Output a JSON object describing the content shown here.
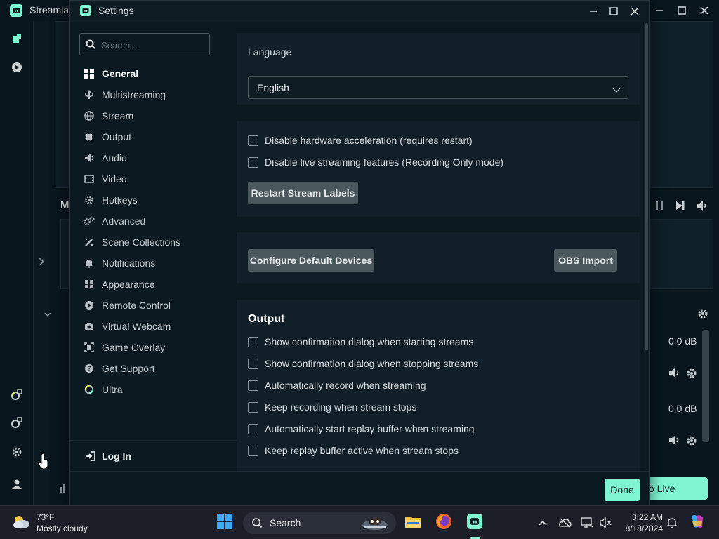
{
  "background_app": {
    "name": "Streamlabs",
    "mixer_label": "M",
    "db_values": [
      "0.0 dB",
      "0.0 dB"
    ],
    "go_live_label": "o Live"
  },
  "dialog": {
    "title": "Settings",
    "search": {
      "placeholder": "Search..."
    },
    "nav_items": [
      {
        "label": "General",
        "icon": "grid-icon"
      },
      {
        "label": "Multistreaming",
        "icon": "usb-fork-icon"
      },
      {
        "label": "Stream",
        "icon": "globe-icon"
      },
      {
        "label": "Output",
        "icon": "chip-icon"
      },
      {
        "label": "Audio",
        "icon": "speaker-icon"
      },
      {
        "label": "Video",
        "icon": "film-icon"
      },
      {
        "label": "Hotkeys",
        "icon": "gear-icon"
      },
      {
        "label": "Advanced",
        "icon": "gears-icon"
      },
      {
        "label": "Scene Collections",
        "icon": "wand-icon"
      },
      {
        "label": "Notifications",
        "icon": "bell-icon"
      },
      {
        "label": "Appearance",
        "icon": "palette-icon"
      },
      {
        "label": "Remote Control",
        "icon": "play-circle-icon"
      },
      {
        "label": "Virtual Webcam",
        "icon": "camera-icon"
      },
      {
        "label": "Game Overlay",
        "icon": "overlay-icon"
      },
      {
        "label": "Get Support",
        "icon": "question-icon"
      },
      {
        "label": "Ultra",
        "icon": "ultra-ring-icon"
      }
    ],
    "active_nav": "General",
    "login_label": "Log In",
    "language": {
      "label": "Language",
      "value": "English"
    },
    "general": {
      "checkboxes": [
        "Disable hardware acceleration (requires restart)",
        "Disable live streaming features (Recording Only mode)"
      ],
      "restart_button": "Restart Stream Labels"
    },
    "devices": {
      "configure_button": "Configure Default Devices",
      "obs_import_button": "OBS Import"
    },
    "output": {
      "heading": "Output",
      "checkboxes": [
        "Show confirmation dialog when starting streams",
        "Show confirmation dialog when stopping streams",
        "Automatically record when streaming",
        "Keep recording when stream stops",
        "Automatically start replay buffer when streaming",
        "Keep replay buffer active when stream stops"
      ]
    },
    "done_button": "Done"
  },
  "taskbar": {
    "weather": {
      "temp": "73°F",
      "condition": "Mostly cloudy"
    },
    "search_label": "Search",
    "clock": {
      "time": "3:22 AM",
      "date": "8/18/2024"
    }
  },
  "colors": {
    "accent": "#80f5d2",
    "dialog_bg": "#0b1a21",
    "card_bg": "#112028",
    "button_bg": "#4a575d"
  }
}
